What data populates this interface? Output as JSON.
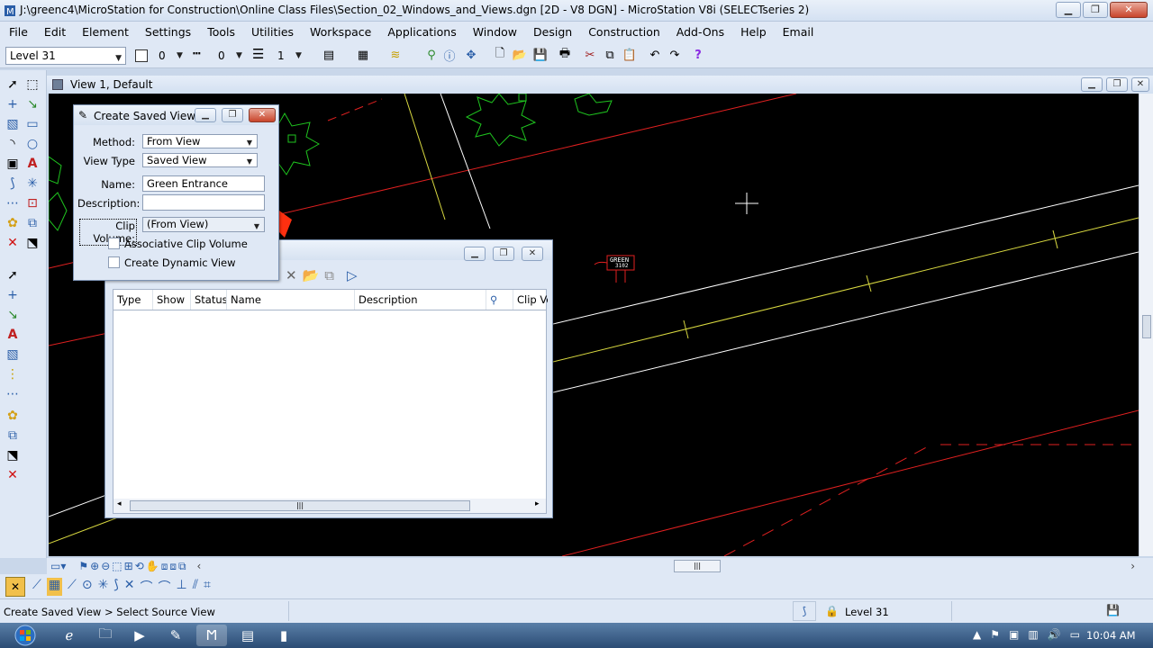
{
  "window": {
    "title": "J:\\greenc4\\MicroStation for Construction\\Online Class Files\\Section_02_Windows_and_Views.dgn [2D - V8 DGN] - MicroStation V8i (SELECTseries 2)"
  },
  "menu": [
    "File",
    "Edit",
    "Element",
    "Settings",
    "Tools",
    "Utilities",
    "Workspace",
    "Applications",
    "Window",
    "Design",
    "Construction",
    "Add-Ons",
    "Help",
    "Email"
  ],
  "attributes": {
    "level": "Level 31",
    "color": "0",
    "style": "0",
    "weight": "1"
  },
  "view": {
    "title": "View 1, Default",
    "green_label": "GREEN",
    "green_sub": "3102"
  },
  "create_saved_view": {
    "title": "Create Saved View",
    "method_label": "Method:",
    "method_value": "From View",
    "view_type_label": "View Type",
    "view_type_value": "Saved View",
    "name_label": "Name:",
    "name_value": "Green Entrance",
    "description_label": "Description:",
    "description_value": "",
    "clip_volume_label": "Clip Volume:",
    "clip_volume_value": "(From View)",
    "assoc_clip_label": "Associative Clip Volume",
    "dynamic_view_label": "Create Dynamic View"
  },
  "saved_views": {
    "columns": [
      "Type",
      "Show",
      "Status",
      "Name",
      "Description",
      "Clip Vo"
    ]
  },
  "status": {
    "prompt": "Create Saved View > Select Source View",
    "level": "Level 31"
  },
  "taskbar": {
    "time": "10:04 AM"
  },
  "colors": {
    "canvas": "#000000",
    "red_lines": "#e02020",
    "green_shapes": "#1fc41f",
    "white_lines": "#ffffff",
    "yellow_lines": "#d8d840"
  }
}
